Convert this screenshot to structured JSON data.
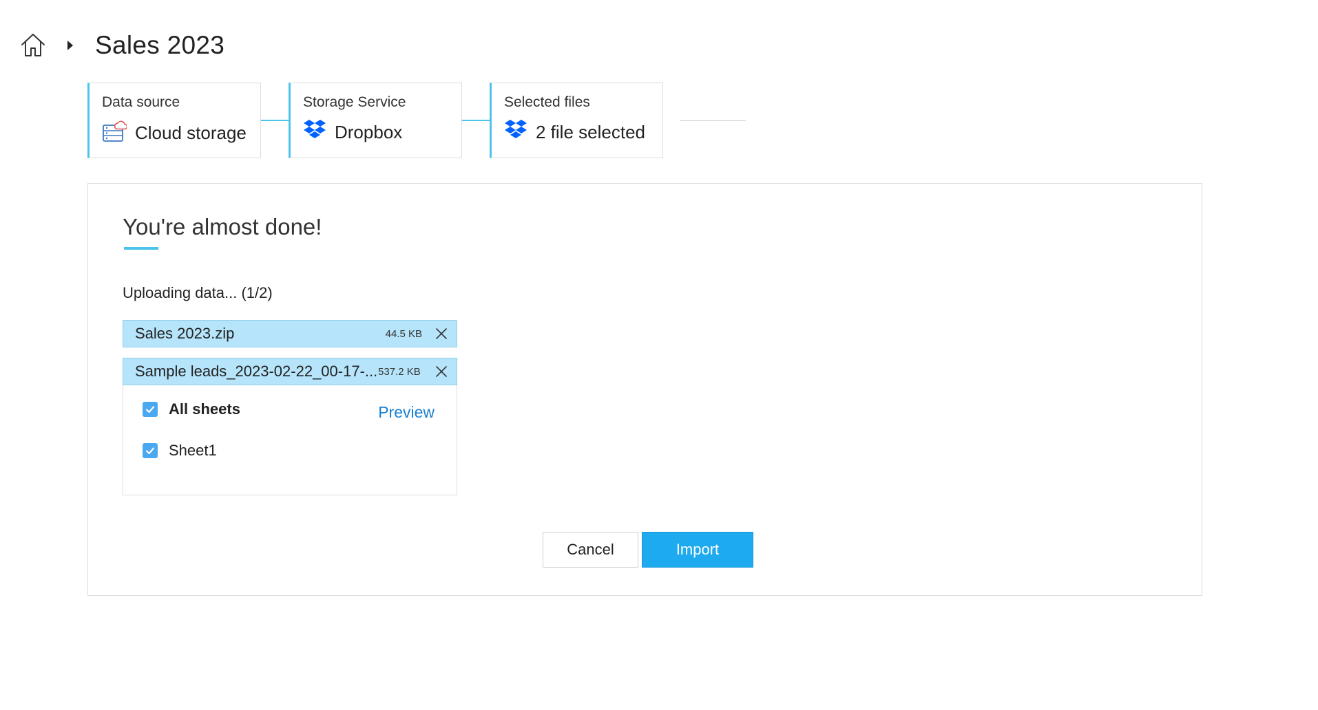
{
  "header": {
    "title": "Sales 2023",
    "home_icon": "home-icon",
    "separator_icon": "caret-right-icon"
  },
  "stepper": {
    "steps": [
      {
        "label": "Data source",
        "value": "Cloud storage",
        "icon": "cloud-storage-icon"
      },
      {
        "label": "Storage Service",
        "value": "Dropbox",
        "icon": "dropbox-icon"
      },
      {
        "label": "Selected files",
        "value": "2 file selected",
        "icon": "dropbox-icon"
      }
    ]
  },
  "panel": {
    "heading": "You're almost done!",
    "status": "Uploading data... (1/2)",
    "files": [
      {
        "name": "Sales 2023.zip",
        "size": "44.5 KB"
      },
      {
        "name": "Sample leads_2023-02-22_00-17-...",
        "size": "537.2 KB"
      }
    ],
    "sheets": {
      "all_label": "All sheets",
      "all_checked": true,
      "items": [
        {
          "label": "Sheet1",
          "checked": true
        }
      ]
    },
    "preview_label": "Preview"
  },
  "actions": {
    "cancel_label": "Cancel",
    "import_label": "Import"
  },
  "colors": {
    "accent": "#4dc3ec",
    "primary_button": "#1eaaee",
    "file_row": "#b6e4fa",
    "link": "#1a7fd0",
    "checkbox": "#4aa8f0"
  }
}
